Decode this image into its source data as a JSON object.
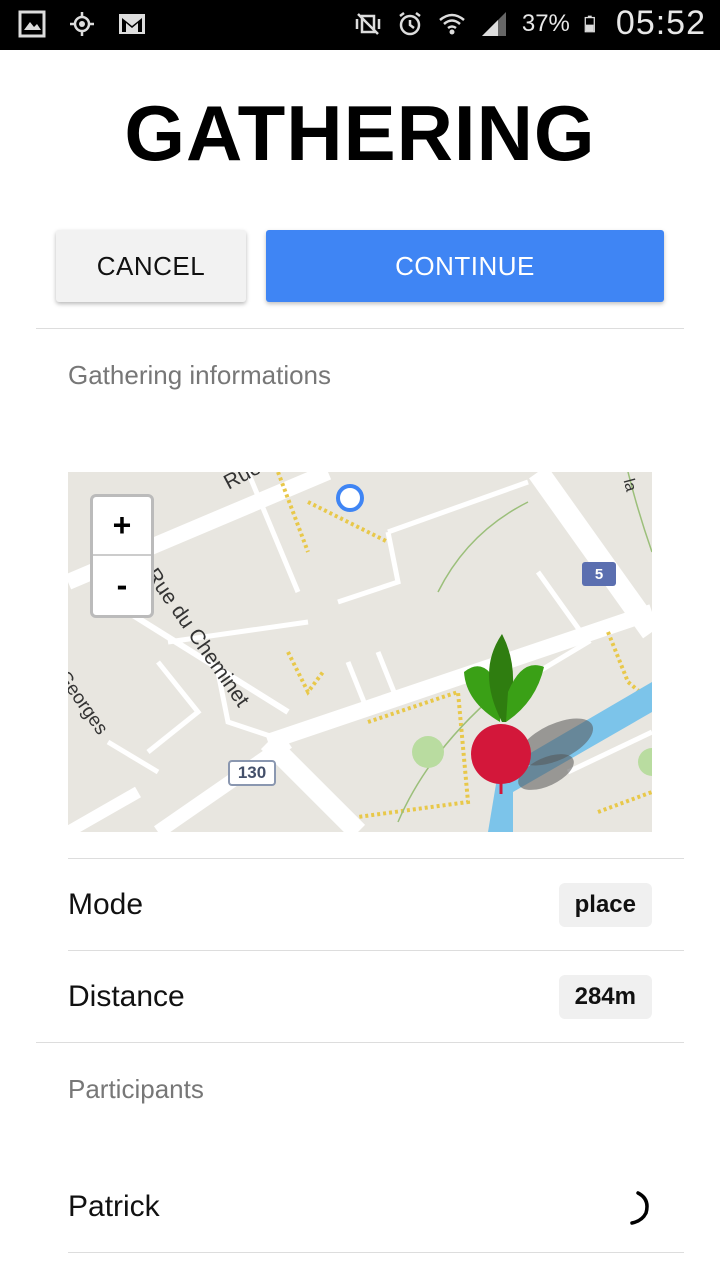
{
  "status_bar": {
    "battery": "37%",
    "time": "05:52"
  },
  "page": {
    "title": "GATHERING"
  },
  "actions": {
    "cancel_label": "CANCEL",
    "continue_label": "CONTINUE"
  },
  "info": {
    "section_label": "Gathering informations"
  },
  "map": {
    "zoom_in": "+",
    "zoom_out": "-",
    "street_labels": [
      "Rue d",
      "Rue du Cheminet",
      "Georges",
      "la"
    ],
    "road_badges": [
      "130",
      "5"
    ],
    "icons": [
      "location-dot-icon",
      "radish-marker-icon"
    ]
  },
  "details": [
    {
      "label": "Mode",
      "value": "place"
    },
    {
      "label": "Distance",
      "value": "284m"
    }
  ],
  "participants": {
    "section_label": "Participants",
    "items": [
      {
        "name": "Patrick"
      }
    ]
  },
  "colors": {
    "accent": "#3f85f4",
    "map_bg": "#e8e6e0",
    "marker_red": "#d3173a",
    "marker_green": "#2f8a14"
  }
}
